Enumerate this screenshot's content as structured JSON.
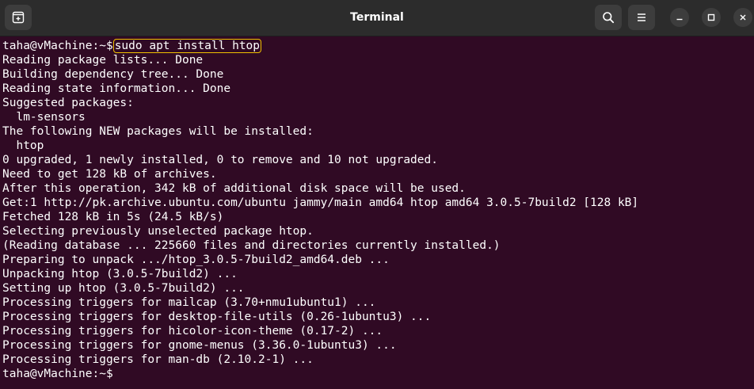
{
  "window": {
    "title": "Terminal",
    "icons": {
      "new_tab": "new-tab-icon",
      "search": "search-icon",
      "menu": "hamburger-menu-icon",
      "minimize": "minimize-icon",
      "maximize": "maximize-icon",
      "close": "close-icon"
    }
  },
  "colors": {
    "terminal_bg": "#300a24",
    "titlebar_bg": "#2c2c2c",
    "text": "#ffffff",
    "highlight": "#f0c000"
  },
  "terminal": {
    "prompt": "taha@vMachine:~$",
    "command": "sudo apt install htop",
    "output": [
      "Reading package lists... Done",
      "Building dependency tree... Done",
      "Reading state information... Done",
      "Suggested packages:",
      "  lm-sensors",
      "The following NEW packages will be installed:",
      "  htop",
      "0 upgraded, 1 newly installed, 0 to remove and 10 not upgraded.",
      "Need to get 128 kB of archives.",
      "After this operation, 342 kB of additional disk space will be used.",
      "Get:1 http://pk.archive.ubuntu.com/ubuntu jammy/main amd64 htop amd64 3.0.5-7build2 [128 kB]",
      "Fetched 128 kB in 5s (24.5 kB/s)",
      "Selecting previously unselected package htop.",
      "(Reading database ... 225660 files and directories currently installed.)",
      "Preparing to unpack .../htop_3.0.5-7build2_amd64.deb ...",
      "Unpacking htop (3.0.5-7build2) ...",
      "Setting up htop (3.0.5-7build2) ...",
      "Processing triggers for mailcap (3.70+nmu1ubuntu1) ...",
      "Processing triggers for desktop-file-utils (0.26-1ubuntu3) ...",
      "Processing triggers for hicolor-icon-theme (0.17-2) ...",
      "Processing triggers for gnome-menus (3.36.0-1ubuntu3) ...",
      "Processing triggers for man-db (2.10.2-1) ..."
    ],
    "final_prompt": "taha@vMachine:~$"
  }
}
